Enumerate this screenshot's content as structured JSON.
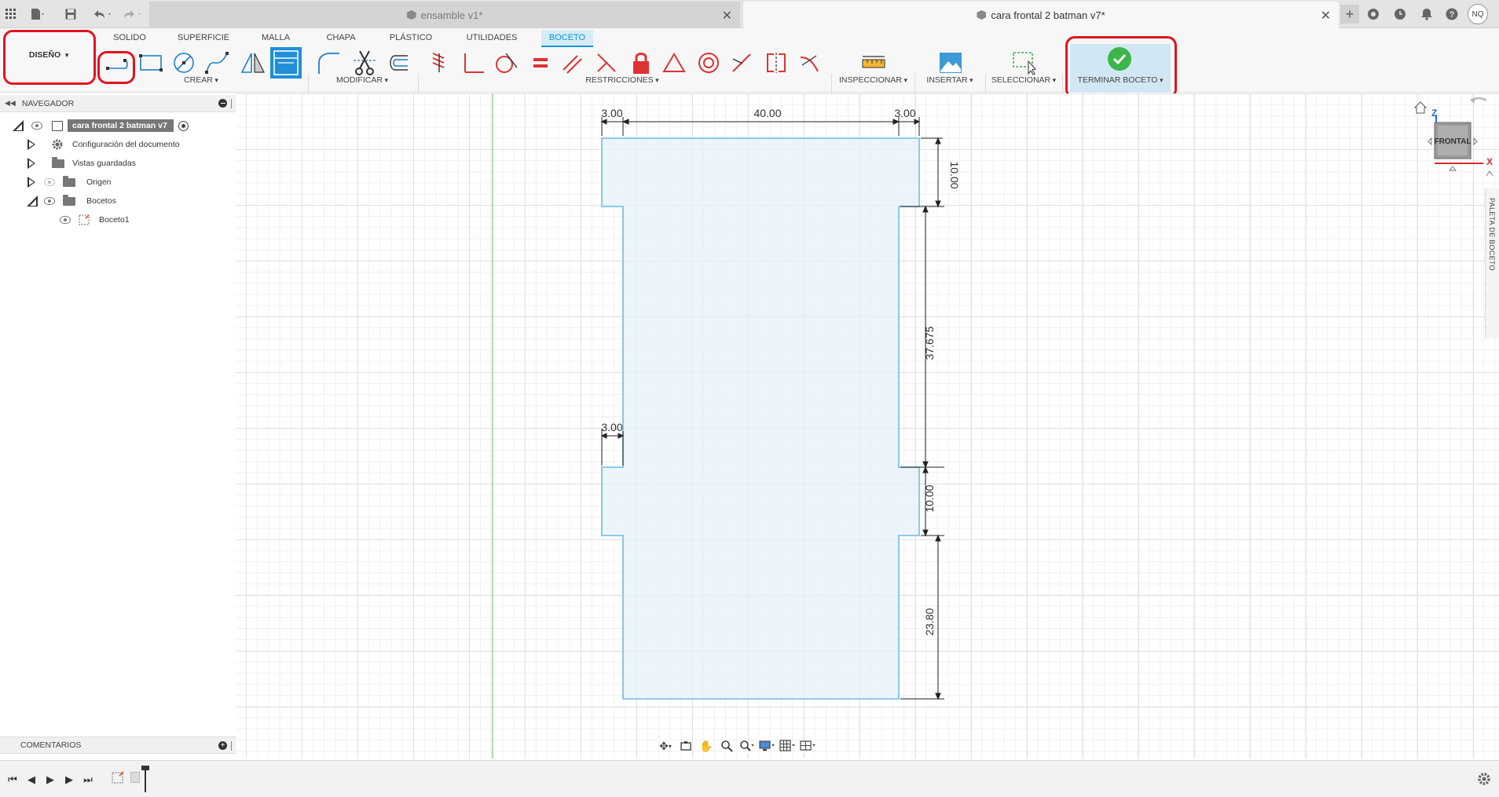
{
  "doc_tabs": [
    {
      "label": "ensamble v1*",
      "active": false
    },
    {
      "label": "cara frontal 2 batman v7*",
      "active": true
    }
  ],
  "user_initials": "NQ",
  "workspace": {
    "label": "DISEÑO"
  },
  "ribbon_tabs": [
    "SOLIDO",
    "SUPERFICIE",
    "MALLA",
    "CHAPA",
    "PLÁSTICO",
    "UTILIDADES",
    "BOCETO"
  ],
  "ribbon_groups": {
    "crear": "CREAR",
    "modificar": "MODIFICAR",
    "restricciones": "RESTRICCIONES",
    "inspeccionar": "INSPECCIONAR",
    "insertar": "INSERTAR",
    "seleccionar": "SELECCIONAR",
    "terminar": "TERMINAR BOCETO"
  },
  "browser": {
    "title": "NAVEGADOR",
    "items": [
      {
        "label": "cara frontal 2 batman v7"
      },
      {
        "label": "Configuración del documento"
      },
      {
        "label": "Vistas guardadas"
      },
      {
        "label": "Origen"
      },
      {
        "label": "Bocetos"
      },
      {
        "label": "Boceto1"
      }
    ]
  },
  "comments": {
    "label": "COMENTARIOS"
  },
  "viewcube": {
    "face": "FRONTAL",
    "axis_z": "Z",
    "axis_x": "X"
  },
  "palette": {
    "label": "PALETA DE BOCETO"
  },
  "dimensions": {
    "top_left": "3.00",
    "top_mid": "40.00",
    "top_right": "3.00",
    "right_1": "10.00",
    "right_2": "37.675",
    "right_3": "10.00",
    "right_4": "23.80",
    "left_notch": "3.00"
  },
  "colors": {
    "accent": "#0696d7",
    "highlight": "#e0141e",
    "finish": "#3cb54a",
    "sketch_fill": "#e6f2fa",
    "sketch_line": "#7ec3e6"
  }
}
